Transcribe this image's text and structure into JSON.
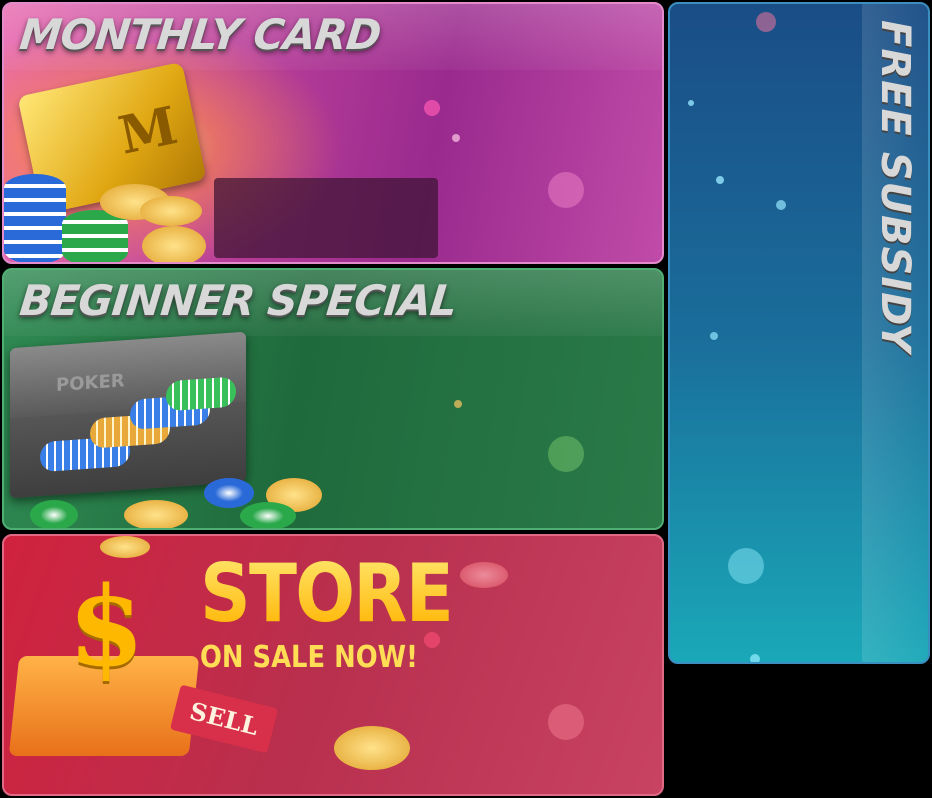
{
  "panels": {
    "monthly_card": {
      "title": "MONTHLY CARD",
      "card_letter": "M"
    },
    "beginner_special": {
      "title": "BEGINNER SPECIAL",
      "case_label": "POKER"
    },
    "store": {
      "title": "STORE",
      "subtitle": "ON SALE NOW!",
      "tag_label": "SELL"
    },
    "free_subsidy": {
      "title": "FREE SUBSIDY"
    }
  },
  "colors": {
    "monthly": "#b43c98",
    "beginner": "#2a7a48",
    "store": "#c8304a",
    "subsidy": "#1a6d9a"
  },
  "icons": [
    "gold-card-icon",
    "chip-stack-icon",
    "briefcase-icon",
    "dollar-icon",
    "shopping-cart-icon",
    "sell-tag-icon",
    "coin-icon"
  ]
}
